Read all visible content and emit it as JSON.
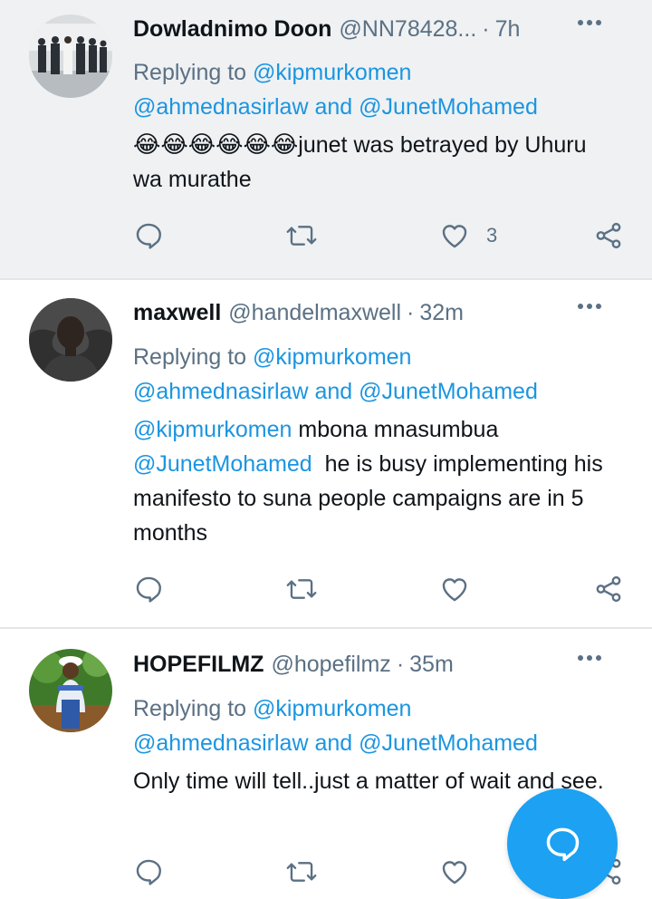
{
  "tweets": [
    {
      "name": "Dowladnimo Doon",
      "handle": "@NN78428...",
      "separator": "·",
      "time": "7h",
      "replying_prefix": "Replying to",
      "reply_to_1": "@kipmurkomen",
      "reply_to_2": "@ahmednasirlaw",
      "and": "and",
      "reply_to_3": "@JunetMohamed",
      "emojis": "😂😂😂😂😂😂",
      "text": "junet was betrayed by Uhuru wa murathe",
      "like_count": "3"
    },
    {
      "name": "maxwell",
      "handle": "@handelmaxwell",
      "separator": "·",
      "time": "32m",
      "replying_prefix": "Replying to",
      "reply_to_1": "@kipmurkomen",
      "reply_to_2": "@ahmednasirlaw",
      "and": "and",
      "reply_to_3": "@JunetMohamed",
      "mention_1": "@kipmurkomen",
      "text_1": " mbona mnasumbua",
      "mention_2": "@JunetMohamed",
      "text_2": "  he is busy implementing his manifesto to suna people campaigns are in 5 months"
    },
    {
      "name": "HOPEFILMZ",
      "handle": "@hopefilmz",
      "separator": "·",
      "time": "35m",
      "replying_prefix": "Replying to",
      "reply_to_1": "@kipmurkomen",
      "reply_to_2": "@ahmednasirlaw",
      "and": "and",
      "reply_to_3": "@JunetMohamed",
      "text": "Only time will tell..just a matter of wait and see."
    }
  ],
  "icons": {
    "reply": "reply-icon",
    "retweet": "retweet-icon",
    "like": "like-icon",
    "share": "share-icon",
    "more": "more-icon",
    "compose": "compose-reply-icon"
  },
  "colors": {
    "link": "#1b95e0",
    "secondary_text": "#5b7083",
    "highlight_bg": "#eff1f3",
    "fab": "#1da1f2"
  }
}
